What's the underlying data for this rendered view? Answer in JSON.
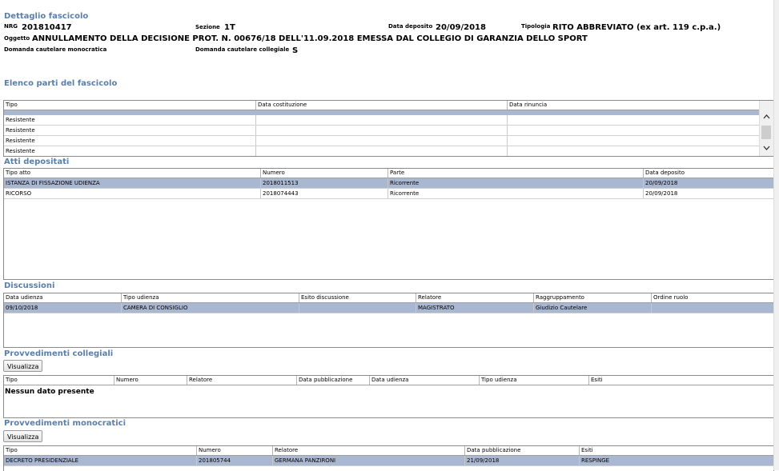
{
  "detail": {
    "title": "Dettaglio fascicolo",
    "nrg_label": "NRG",
    "nrg_value": "201810417",
    "sezione_label": "Sezione",
    "sezione_value": "1T",
    "data_deposito_label": "Data deposito",
    "data_deposito_value": "20/09/2018",
    "tipologia_label": "Tipologia",
    "tipologia_value": "RITO ABBREVIATO (ex art. 119 c.p.a.)",
    "oggetto_label": "Oggetto",
    "oggetto_value": "ANNULLAMENTO DELLA DECISIONE PROT. N. 00676/18 DELL'11.09.2018 EMESSA DAL COLLEGIO DI GARANZIA DELLO SPORT",
    "domanda_monocratica_label": "Domanda cautelare monocratica",
    "domanda_collegiale_label": "Domanda cautelare collegiale",
    "domanda_collegiale_value": "S"
  },
  "parti": {
    "title": "Elenco parti del fascicolo",
    "columns": [
      "Tipo",
      "Data costituzione",
      "Data rinuncia"
    ],
    "rows": [
      [
        "Resistente",
        "",
        ""
      ],
      [
        "Resistente",
        "",
        ""
      ],
      [
        "Resistente",
        "",
        ""
      ],
      [
        "Resistente",
        "",
        ""
      ]
    ],
    "scroll_up": "^",
    "scroll_down": "v"
  },
  "atti": {
    "title": "Atti depositati",
    "columns": [
      "Tipo atto",
      "Numero",
      "Parte",
      "Data deposito"
    ],
    "rows": [
      [
        "ISTANZA DI FISSAZIONE UDIENZA",
        "2018011513",
        "Ricorrente",
        "20/09/2018"
      ],
      [
        "RICORSO",
        "2018074443",
        "Ricorrente",
        "20/09/2018"
      ]
    ]
  },
  "discussioni": {
    "title": "Discussioni",
    "columns": [
      "Data udienza",
      "Tipo udienza",
      "Esito discussione",
      "Relatore",
      "Raggruppamento",
      "Ordine ruolo"
    ],
    "rows": [
      [
        "09/10/2018",
        "CAMERA DI CONSIGLIO",
        "",
        "MAGISTRATO",
        "Giudizio Cautelare",
        ""
      ]
    ]
  },
  "collegiali": {
    "title": "Provvedimenti collegiali",
    "button": "Visualizza",
    "columns": [
      "Tipo",
      "Numero",
      "Relatore",
      "Data pubblicazione",
      "Data udienza",
      "Tipo udienza",
      "Esiti"
    ],
    "empty": "Nessun dato presente"
  },
  "monocratici": {
    "title": "Provvedimenti monocratici",
    "button": "Visualizza",
    "columns": [
      "Tipo",
      "Numero",
      "Relatore",
      "Data pubblicazione",
      "Esiti"
    ],
    "rows": [
      [
        "DECRETO PRESIDENZIALE",
        "201805744",
        "GERMANA PANZIRONI",
        "21/09/2018",
        "RESPINGE"
      ]
    ]
  }
}
